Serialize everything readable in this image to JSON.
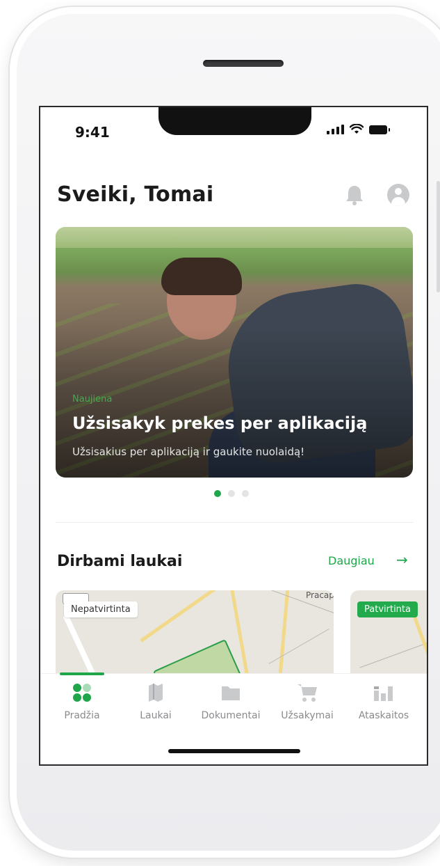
{
  "status_bar": {
    "time": "9:41"
  },
  "header": {
    "greeting": "Sveiki, Tomai"
  },
  "banner": {
    "tag": "Naujiena",
    "title": "Užsisakyk prekes per aplikaciją",
    "subtitle": "Užsisakius per aplikaciją ir gaukite nuolaidą!",
    "slides_total": 3,
    "active_slide": 1
  },
  "fields_section": {
    "title": "Dirbami laukai",
    "more_label": "Daugiau",
    "cards": [
      {
        "status": "Nepatvirtinta",
        "map_label": "Pracap."
      },
      {
        "status": "Patvirtinta"
      }
    ]
  },
  "tabbar": {
    "items": [
      {
        "label": "Pradžia",
        "icon": "home-grid-icon",
        "active": true
      },
      {
        "label": "Laukai",
        "icon": "map-icon",
        "active": false
      },
      {
        "label": "Dokumentai",
        "icon": "folder-icon",
        "active": false
      },
      {
        "label": "Užsakymai",
        "icon": "cart-icon",
        "active": false
      },
      {
        "label": "Ataskaitos",
        "icon": "chart-icon",
        "active": false
      }
    ]
  },
  "colors": {
    "accent": "#1fa64a",
    "muted": "#8b8b8e",
    "text": "#1b1b1b"
  }
}
